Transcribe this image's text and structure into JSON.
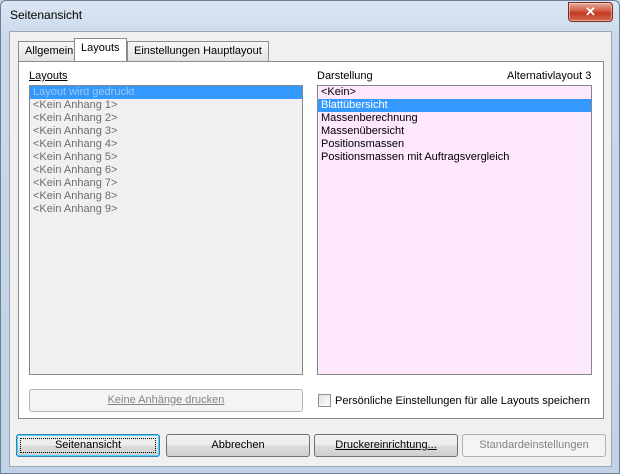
{
  "window": {
    "title": "Seitenansicht",
    "close_glyph": "✕"
  },
  "tabs": [
    {
      "label": "Allgemein",
      "active": false
    },
    {
      "label": "Layouts",
      "active": true
    },
    {
      "label": "Einstellungen Hauptlayout",
      "active": false
    }
  ],
  "left": {
    "label": "Layouts",
    "items": [
      {
        "text": "Layout wird gedruckt",
        "selected": true,
        "disabled": true
      },
      {
        "text": "<Kein Anhang 1>",
        "disabled": true
      },
      {
        "text": "<Kein Anhang 2>",
        "disabled": true
      },
      {
        "text": "<Kein Anhang 3>",
        "disabled": true
      },
      {
        "text": "<Kein Anhang 4>",
        "disabled": true
      },
      {
        "text": "<Kein Anhang 5>",
        "disabled": true
      },
      {
        "text": "<Kein Anhang 6>",
        "disabled": true
      },
      {
        "text": "<Kein Anhang 7>",
        "disabled": true
      },
      {
        "text": "<Kein Anhang 8>",
        "disabled": true
      },
      {
        "text": "<Kein Anhang 9>",
        "disabled": true
      }
    ],
    "button": "Keine Anhänge drucken"
  },
  "right": {
    "label": "Darstellung",
    "alt_label": "Alternativlayout 3",
    "items": [
      {
        "text": "<Kein>"
      },
      {
        "text": "Blattübersicht",
        "selected": true
      },
      {
        "text": "Massenberechnung"
      },
      {
        "text": "Massenübersicht"
      },
      {
        "text": "Positionsmassen"
      },
      {
        "text": "Positionsmassen mit Auftragsvergleich"
      }
    ],
    "checkbox_label": "Persönliche Einstellungen für alle Layouts speichern",
    "checkbox_checked": false
  },
  "buttons": {
    "preview": "Seitenansicht",
    "cancel": "Abbrechen",
    "printer_setup": "Druckereinrichtung...",
    "defaults": "Standardeinstellungen"
  }
}
